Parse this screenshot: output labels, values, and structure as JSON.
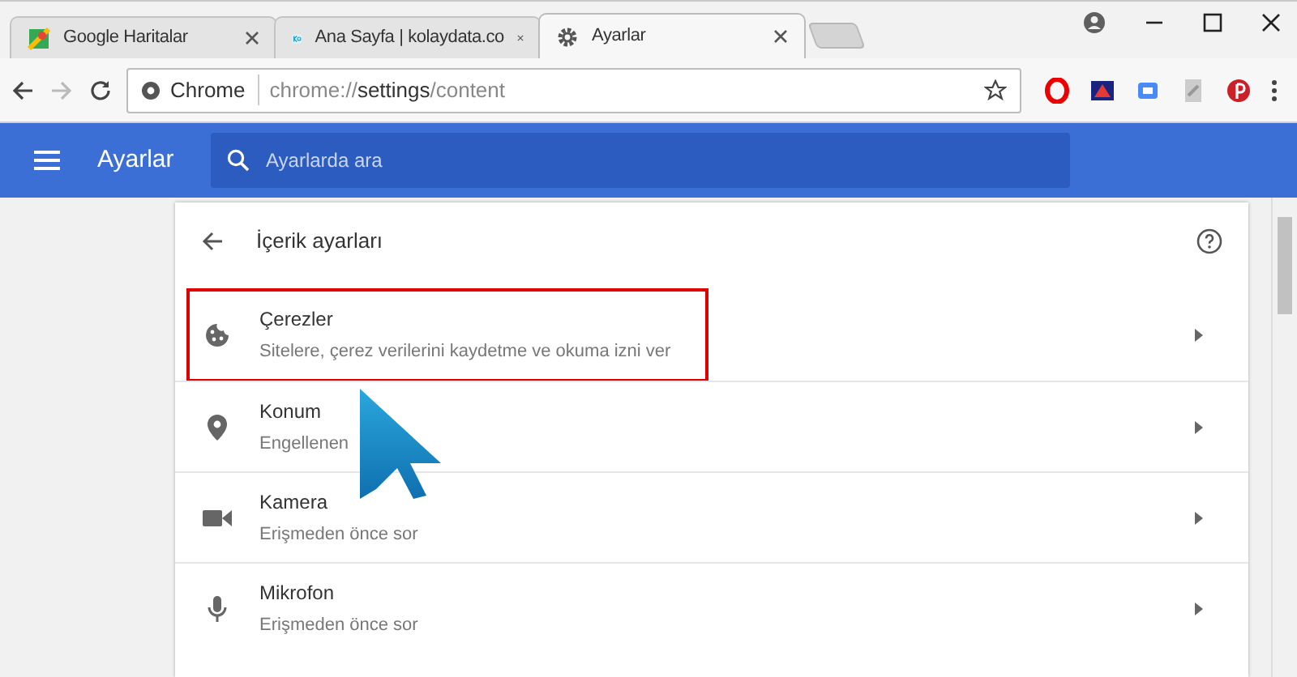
{
  "tabs": [
    {
      "title": "Google Haritalar",
      "kind": "maps",
      "selected": false
    },
    {
      "title": "Ana Sayfa | kolaydata.co",
      "kind": "site",
      "selected": false
    },
    {
      "title": "Ayarlar",
      "kind": "settings",
      "selected": true
    }
  ],
  "omnibox": {
    "site_label": "Chrome",
    "url_scheme": "chrome://",
    "url_host": "settings",
    "url_path": "/content"
  },
  "header": {
    "title": "Ayarlar",
    "search_placeholder": "Ayarlarda ara"
  },
  "section": {
    "title": "İçerik ayarları"
  },
  "items": [
    {
      "kind": "cookie",
      "title": "Çerezler",
      "subtitle": "Sitelere, çerez verilerini kaydetme ve okuma izni ver",
      "highlighted": true
    },
    {
      "kind": "location",
      "title": "Konum",
      "subtitle": "Engellenen",
      "highlighted": false
    },
    {
      "kind": "camera",
      "title": "Kamera",
      "subtitle": "Erişmeden önce sor",
      "highlighted": false
    },
    {
      "kind": "mic",
      "title": "Mikrofon",
      "subtitle": "Erişmeden önce sor",
      "highlighted": false
    }
  ]
}
